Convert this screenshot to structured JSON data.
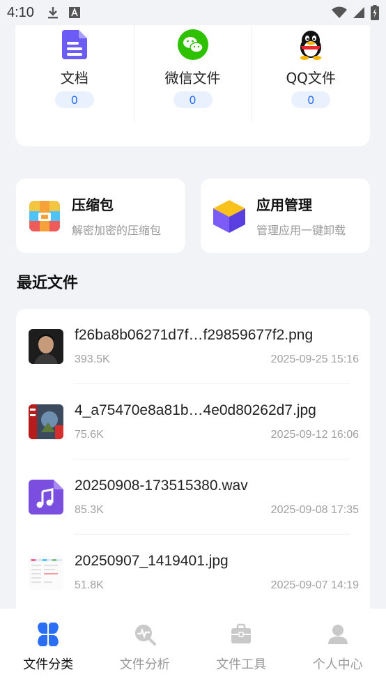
{
  "status_bar": {
    "time": "4:10",
    "icons": [
      "download-icon",
      "a-box-icon",
      "wifi-icon",
      "signal-icon",
      "battery-icon"
    ]
  },
  "categories": [
    {
      "label": "文档",
      "count": "0",
      "icon": "document-icon"
    },
    {
      "label": "微信文件",
      "count": "0",
      "icon": "wechat-icon"
    },
    {
      "label": "QQ文件",
      "count": "0",
      "icon": "qq-icon"
    }
  ],
  "tools": [
    {
      "title": "压缩包",
      "subtitle": "解密加密的压缩包",
      "icon": "archive-icon"
    },
    {
      "title": "应用管理",
      "subtitle": "管理应用一键卸载",
      "icon": "app-box-icon"
    }
  ],
  "recent": {
    "title": "最近文件",
    "files": [
      {
        "name": "f26ba8b06271d7f…f29859677f2.png",
        "size": "393.5K",
        "date": "2025-09-25 15:16",
        "thumb": "photo-portrait"
      },
      {
        "name": "4_a75470e8a81b…4e0d80262d7.jpg",
        "size": "75.6K",
        "date": "2025-09-12 16:06",
        "thumb": "photo-poster"
      },
      {
        "name": "20250908-173515380.wav",
        "size": "85.3K",
        "date": "2025-09-08 17:35",
        "thumb": "audio-file-icon"
      },
      {
        "name": "20250907_1419401.jpg",
        "size": "51.8K",
        "date": "2025-09-07 14:19",
        "thumb": "screenshot-thumb"
      }
    ]
  },
  "bottom_nav": [
    {
      "label": "文件分类",
      "icon": "category-icon",
      "active": true
    },
    {
      "label": "文件分析",
      "icon": "analysis-icon",
      "active": false
    },
    {
      "label": "文件工具",
      "icon": "toolbox-icon",
      "active": false
    },
    {
      "label": "个人中心",
      "icon": "user-icon",
      "active": false
    }
  ],
  "colors": {
    "accent": "#2a6ef5",
    "background": "#f2f3f7",
    "doc_icon": "#6b5cf6",
    "wechat_green": "#2dc100",
    "audio_purple": "#7a4fe0"
  }
}
